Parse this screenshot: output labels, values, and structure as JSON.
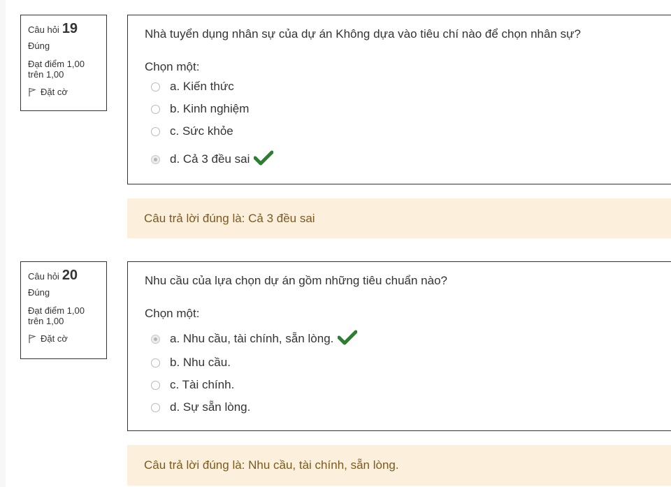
{
  "colors": {
    "info_border": "#333333",
    "content_border": "#333333",
    "feedback_bg": "#fcefdc",
    "feedback_text": "#7a5a1e",
    "check_green": "#2e7d32"
  },
  "questions": [
    {
      "label": "Câu hỏi",
      "number": "19",
      "state": "Đúng",
      "grade": "Đạt điểm 1,00 trên 1,00",
      "flag_label": "Đặt cờ",
      "text": "Nhà tuyển dụng nhân sự của dự án Không dựa vào tiêu chí nào để chọn nhân sự?",
      "prompt": "Chọn một:",
      "answers": [
        {
          "label": "a. Kiến thức",
          "selected": false
        },
        {
          "label": "b. Kinh nghiệm",
          "selected": false
        },
        {
          "label": "c. Sức khỏe",
          "selected": false
        },
        {
          "label": "d. Cả 3 đều sai",
          "selected": true,
          "correct_icon": "checkmark-icon"
        }
      ],
      "feedback": "Câu trả lời đúng là: Cả 3 đều sai"
    },
    {
      "label": "Câu hỏi",
      "number": "20",
      "state": "Đúng",
      "grade": "Đạt điểm 1,00 trên 1,00",
      "flag_label": "Đặt cờ",
      "text": "Nhu cầu của lựa chọn dự án gồm những tiêu chuẩn nào?",
      "prompt": "Chọn một:",
      "answers": [
        {
          "label": "a. Nhu cầu, tài chính, sẵn lòng.",
          "selected": true,
          "correct_icon": "checkmark-icon"
        },
        {
          "label": "b. Nhu cầu.",
          "selected": false
        },
        {
          "label": "c. Tài chính.",
          "selected": false
        },
        {
          "label": "d. Sự sẵn lòng.",
          "selected": false
        }
      ],
      "feedback": "Câu trả lời đúng là: Nhu cầu, tài chính, sẵn lòng."
    }
  ]
}
